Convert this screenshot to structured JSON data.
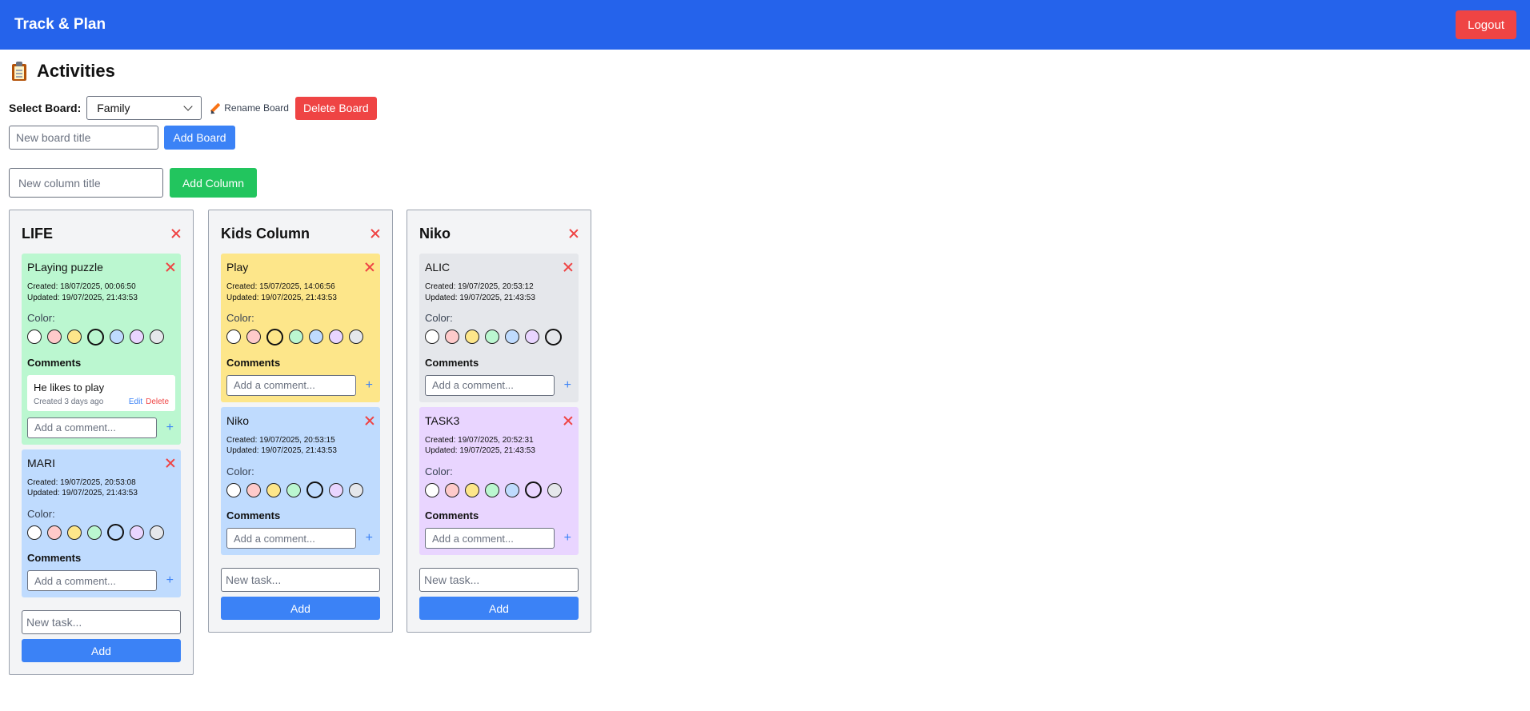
{
  "app": {
    "title": "Track & Plan",
    "logout_label": "Logout"
  },
  "page": {
    "title": "Activities",
    "icon": "clipboard-icon"
  },
  "board_controls": {
    "select_label": "Select Board:",
    "selected_board": "Family",
    "rename_label": "Rename Board",
    "delete_label": "Delete Board",
    "new_board_placeholder": "New board title",
    "add_board_label": "Add Board",
    "new_column_placeholder": "New column title",
    "add_column_label": "Add Column"
  },
  "colors": {
    "white": "#ffffff",
    "red": "#fecaca",
    "yellow": "#fde68a",
    "green": "#bbf7d0",
    "blue": "#bfdbfe",
    "purple": "#e9d5ff",
    "gray": "#e5e7eb",
    "header": "#2563eb",
    "danger": "#ef4444",
    "primary": "#3b82f6",
    "success": "#22c55e"
  },
  "labels": {
    "color": "Color:",
    "comments": "Comments",
    "comment_placeholder": "Add a comment...",
    "new_task_placeholder": "New task...",
    "add_task": "Add",
    "edit": "Edit",
    "delete": "Delete"
  },
  "columns": [
    {
      "title": "LIFE",
      "cards": [
        {
          "title": "PLaying puzzle",
          "created": "Created: 18/07/2025, 00:06:50",
          "updated": "Updated: 19/07/2025, 21:43:53",
          "color": "green",
          "comments": [
            {
              "text": "He likes to play",
              "time": "Created 3 days ago"
            }
          ]
        },
        {
          "title": "MARI",
          "created": "Created: 19/07/2025, 20:53:08",
          "updated": "Updated: 19/07/2025, 21:43:53",
          "color": "blue",
          "comments": []
        }
      ]
    },
    {
      "title": "Kids Column",
      "cards": [
        {
          "title": "Play",
          "created": "Created: 15/07/2025, 14:06:56",
          "updated": "Updated: 19/07/2025, 21:43:53",
          "color": "yellow",
          "comments": []
        },
        {
          "title": "Niko",
          "created": "Created: 19/07/2025, 20:53:15",
          "updated": "Updated: 19/07/2025, 21:43:53",
          "color": "blue",
          "comments": []
        }
      ]
    },
    {
      "title": "Niko",
      "cards": [
        {
          "title": "ALIC",
          "created": "Created: 19/07/2025, 20:53:12",
          "updated": "Updated: 19/07/2025, 21:43:53",
          "color": "gray",
          "comments": []
        },
        {
          "title": "TASK3",
          "created": "Created: 19/07/2025, 20:52:31",
          "updated": "Updated: 19/07/2025, 21:43:53",
          "color": "purple",
          "comments": []
        }
      ]
    }
  ]
}
